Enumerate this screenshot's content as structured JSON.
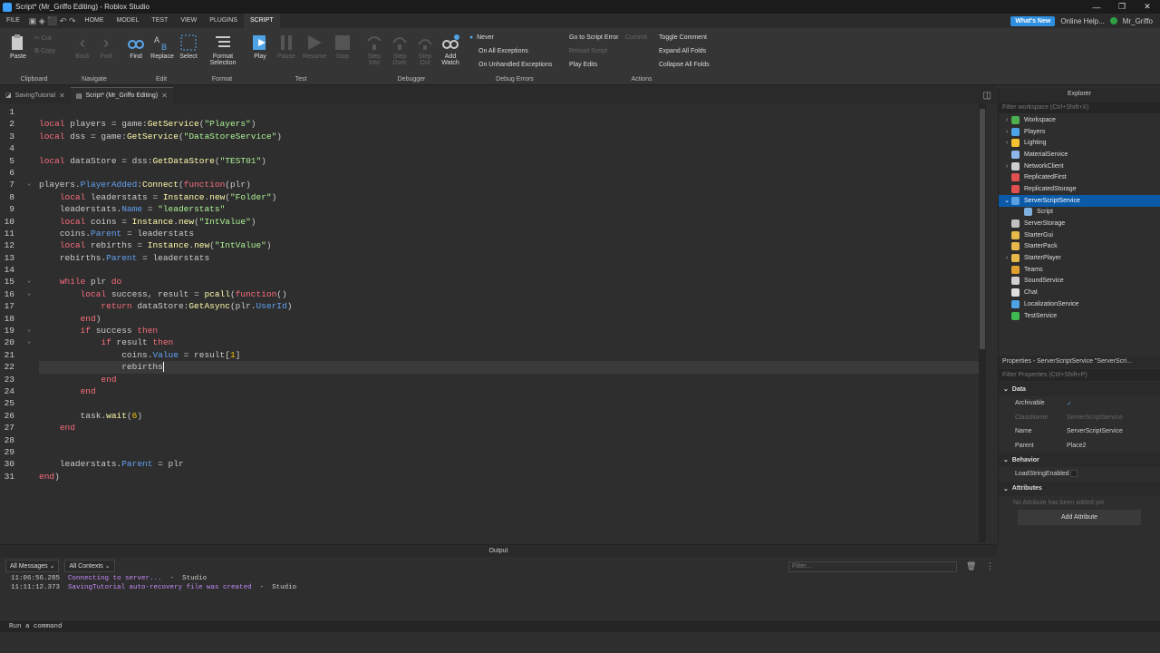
{
  "window": {
    "title": "Script* (Mr_Griffo Editing) - Roblox Studio",
    "min": "—",
    "max": "❐",
    "close": "✕"
  },
  "menu": {
    "file": "FILE",
    "tabs": [
      "HOME",
      "MODEL",
      "TEST",
      "VIEW",
      "PLUGINS",
      "SCRIPT"
    ],
    "whats_new": "What's New",
    "online_help": "Online Help...",
    "user": "Mr_Griffo"
  },
  "ribbon": {
    "clipboard": {
      "label": "Clipboard",
      "paste": "Paste",
      "cut": "Cut",
      "copy": "Copy"
    },
    "navigate": {
      "label": "Navigate",
      "back": "Back",
      "fwd": "Fwd"
    },
    "edit": {
      "label": "Edit",
      "find": "Find",
      "replace": "Replace",
      "select": "Select"
    },
    "format": {
      "label": "Format",
      "format_selection": "Format Selection"
    },
    "test": {
      "label": "Test",
      "play": "Play",
      "pause": "Pause",
      "resume": "Resume",
      "stop": "Stop"
    },
    "debugger": {
      "label": "Debugger",
      "step_into": "Step Into",
      "step_over": "Step Over",
      "step_out": "Step Out",
      "add_watch": "Add Watch"
    },
    "debug_errors": {
      "label": "Debug Errors",
      "never": "Never",
      "on_all": "On All Exceptions",
      "on_unhandled": "On Unhandled Exceptions"
    },
    "actions": {
      "label": "Actions",
      "goto_error": "Go to Script Error",
      "commit": "Commit",
      "reload": "Reload Script",
      "play_edits": "Play Edits",
      "toggle_comment": "Toggle Comment",
      "expand": "Expand All Folds",
      "collapse": "Collapse All Folds"
    }
  },
  "tabs": [
    {
      "label": "SavingTutorial",
      "close": "✕"
    },
    {
      "label": "Script* (Mr_Griffo Editing)",
      "close": "✕"
    }
  ],
  "editor": {
    "current_line": 22
  },
  "explorer": {
    "title": "Explorer",
    "filter": "Filter workspace (Ctrl+Shift+X)",
    "items": [
      {
        "label": "Workspace",
        "color": "#4caf50"
      },
      {
        "label": "Players",
        "color": "#4ea3e6"
      },
      {
        "label": "Lighting",
        "color": "#f2c230"
      },
      {
        "label": "MaterialService",
        "color": "#8fb6e8"
      },
      {
        "label": "NetworkClient",
        "color": "#cfcfcf"
      },
      {
        "label": "ReplicatedFirst",
        "color": "#e05050"
      },
      {
        "label": "ReplicatedStorage",
        "color": "#e05050"
      },
      {
        "label": "ServerScriptService",
        "color": "#5aa0e0"
      },
      {
        "label": "Script",
        "color": "#7fb0e0"
      },
      {
        "label": "ServerStorage",
        "color": "#c0c0c0"
      },
      {
        "label": "StarterGui",
        "color": "#e6b84a"
      },
      {
        "label": "StarterPack",
        "color": "#e6b84a"
      },
      {
        "label": "StarterPlayer",
        "color": "#e6b84a"
      },
      {
        "label": "Teams",
        "color": "#e0a030"
      },
      {
        "label": "SoundService",
        "color": "#d0d0d0"
      },
      {
        "label": "Chat",
        "color": "#e0e0e0"
      },
      {
        "label": "LocalizationService",
        "color": "#4ea3e6"
      },
      {
        "label": "TestService",
        "color": "#3fb950"
      }
    ]
  },
  "properties": {
    "title": "Properties - ServerScriptService \"ServerScri...",
    "filter": "Filter Properties (Ctrl+Shift+P)",
    "data": "Data",
    "archivable": "Archivable",
    "archivable_val": "✓",
    "classname": "ClassName",
    "classname_val": "ServerScriptService",
    "name": "Name",
    "name_val": "ServerScriptService",
    "parent": "Parent",
    "parent_val": "Place2",
    "behavior": "Behavior",
    "loadstring": "LoadStringEnabled",
    "attributes": "Attributes",
    "no_attr": "No Attribute has been added yet",
    "add_attr": "Add Attribute"
  },
  "output": {
    "title": "Output",
    "all_messages": "All Messages",
    "all_contexts": "All Contexts",
    "filter": "Filter...",
    "logs": [
      {
        "time": "11:06:56.285",
        "msg": "Connecting to server...",
        "src": "  -  Studio"
      },
      {
        "time": "11:11:12.373",
        "msg": "SavingTutorial auto-recovery file was created",
        "src": "  -  Studio"
      }
    ]
  },
  "command": {
    "placeholder": "Run a command"
  }
}
